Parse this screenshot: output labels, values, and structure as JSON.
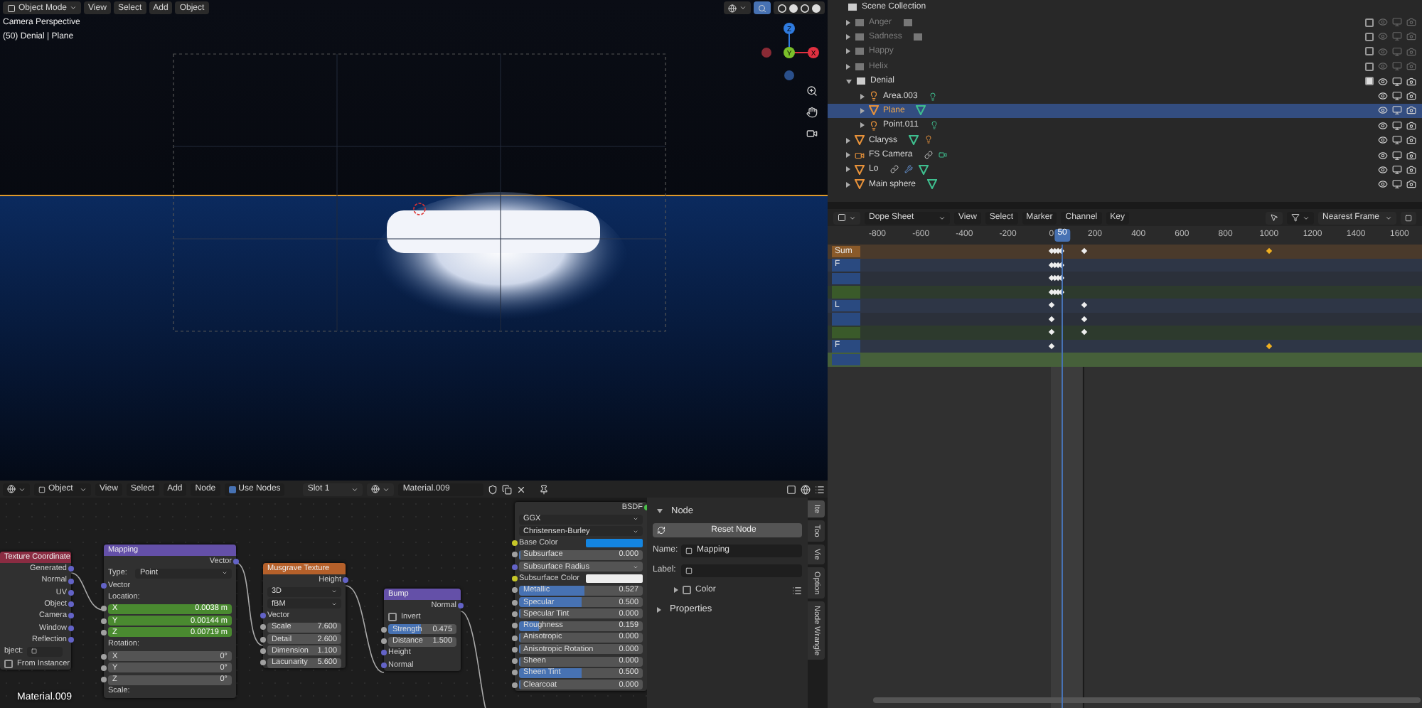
{
  "viewport": {
    "mode": "Object Mode",
    "menus": [
      "View",
      "Select",
      "Add",
      "Object"
    ],
    "overlay": [
      "Camera Perspective",
      "(50) Denial | Plane"
    ],
    "gizmo": {
      "z": "Z",
      "y": "Y",
      "x": "X"
    }
  },
  "outliner": {
    "root": "Scene Collection",
    "items": [
      {
        "name": "Anger",
        "kind": "collection",
        "enabled": false,
        "selected": false,
        "extras": [
          {
            "kind": "collection"
          }
        ]
      },
      {
        "name": "Sadness",
        "kind": "collection",
        "enabled": false,
        "selected": false,
        "extras": [
          {
            "kind": "collection"
          }
        ]
      },
      {
        "name": "Happy",
        "kind": "collection",
        "enabled": false,
        "selected": false
      },
      {
        "name": "Helix",
        "kind": "collection",
        "enabled": false,
        "selected": false
      },
      {
        "name": "Denial",
        "kind": "collection",
        "enabled": true,
        "selected": false,
        "children": [
          {
            "name": "Area.003",
            "kind": "light",
            "enabled": true,
            "selected": false,
            "extras": [
              {
                "kind": "light-data"
              }
            ]
          },
          {
            "name": "Plane",
            "kind": "mesh",
            "enabled": true,
            "selected": true,
            "extras": [
              {
                "kind": "mesh-data"
              }
            ]
          },
          {
            "name": "Point.011",
            "kind": "light",
            "enabled": true,
            "selected": false,
            "extras": [
              {
                "kind": "light-data"
              }
            ]
          }
        ]
      },
      {
        "name": "Claryss",
        "kind": "mesh",
        "enabled": true,
        "selected": false,
        "extras": [
          {
            "kind": "mesh-data"
          },
          {
            "kind": "light"
          }
        ]
      },
      {
        "name": "FS Camera",
        "kind": "camera",
        "enabled": true,
        "selected": false,
        "extras": [
          {
            "kind": "constraint"
          },
          {
            "kind": "camera-data"
          }
        ]
      },
      {
        "name": "Lo",
        "kind": "mesh",
        "enabled": true,
        "selected": false,
        "extras": [
          {
            "kind": "constraint"
          },
          {
            "kind": "modifier"
          },
          {
            "kind": "mesh-data"
          }
        ]
      },
      {
        "name": "Main sphere",
        "kind": "mesh",
        "enabled": true,
        "selected": false,
        "extras": [
          {
            "kind": "mesh-data"
          }
        ]
      }
    ]
  },
  "dope_sheet": {
    "mode": "Dope Sheet",
    "menus": [
      "View",
      "Select",
      "Marker",
      "Channel",
      "Key"
    ],
    "snapping": "Nearest Frame",
    "ruler": [
      "-800",
      "-600",
      "-400",
      "-200",
      "0",
      "200",
      "400",
      "600",
      "800",
      "1000",
      "1200",
      "1400",
      "1600"
    ],
    "current_frame": "50",
    "channels": [
      {
        "kind": "summary",
        "label": "Sum"
      },
      {
        "kind": "object",
        "label": "F"
      },
      {
        "kind": "data"
      },
      {
        "kind": "action"
      },
      {
        "kind": "object",
        "label": "L"
      },
      {
        "kind": "data"
      },
      {
        "kind": "action"
      },
      {
        "kind": "object",
        "label": "F"
      },
      {
        "kind": "material"
      }
    ]
  },
  "node_editor": {
    "object_type": "Object",
    "menus": [
      "View",
      "Select",
      "Add",
      "Node"
    ],
    "use_nodes": {
      "label": "Use Nodes",
      "checked": true
    },
    "slot": "Slot 1",
    "material": "Material.009",
    "overlay": "Material.009",
    "nodes": [
      {
        "kind": "input",
        "title": "Texture Coordinate",
        "rows": [
          {
            "kind": "output",
            "label": "Generated"
          },
          {
            "kind": "output",
            "label": "Normal"
          },
          {
            "kind": "output",
            "label": "UV"
          },
          {
            "kind": "output",
            "label": "Object"
          },
          {
            "kind": "output",
            "label": "Camera"
          },
          {
            "kind": "output",
            "label": "Window"
          },
          {
            "kind": "output",
            "label": "Reflection"
          },
          {
            "kind": "object",
            "label": "bject:"
          },
          {
            "kind": "checkbox",
            "label": "From Instancer",
            "checked": false
          }
        ]
      },
      {
        "kind": "vector",
        "title": "Mapping",
        "rows": [
          {
            "kind": "output",
            "label": "Vector"
          },
          {
            "kind": "dropdown",
            "label": "Type:",
            "value": "Point"
          },
          {
            "kind": "input",
            "label": "Vector"
          },
          {
            "kind": "label",
            "label": "Location:"
          },
          {
            "kind": "number",
            "label": "X",
            "value": "0.0038 m",
            "animated": true
          },
          {
            "kind": "number",
            "label": "Y",
            "value": "0.00144 m",
            "animated": true
          },
          {
            "kind": "number",
            "label": "Z",
            "value": "0.00719 m",
            "animated": true
          },
          {
            "kind": "label",
            "label": "Rotation:"
          },
          {
            "kind": "number",
            "label": "X",
            "value": "0°",
            "animated": false
          },
          {
            "kind": "number",
            "label": "Y",
            "value": "0°",
            "animated": false
          },
          {
            "kind": "number",
            "label": "Z",
            "value": "0°",
            "animated": false
          },
          {
            "kind": "label",
            "label": "Scale:"
          }
        ]
      },
      {
        "kind": "texture",
        "title": "Musgrave Texture",
        "rows": [
          {
            "kind": "output",
            "label": "Height"
          },
          {
            "kind": "dropdown",
            "value": "3D"
          },
          {
            "kind": "dropdown",
            "value": "fBM"
          },
          {
            "kind": "input",
            "label": "Vector"
          },
          {
            "kind": "number",
            "label": "Scale",
            "value": "7.600",
            "animated": false
          },
          {
            "kind": "number",
            "label": "Detail",
            "value": "2.600",
            "animated": false
          },
          {
            "kind": "number",
            "label": "Dimension",
            "value": "1.100",
            "animated": false
          },
          {
            "kind": "number",
            "label": "Lacunarity",
            "value": "5.600",
            "animated": false
          }
        ]
      },
      {
        "kind": "vector",
        "title": "Bump",
        "rows": [
          {
            "kind": "output",
            "label": "Normal"
          },
          {
            "kind": "checkbox",
            "label": "Invert",
            "checked": false
          },
          {
            "kind": "slider",
            "label": "Strength",
            "value": "0.475",
            "level": 0.475
          },
          {
            "kind": "number",
            "label": "Distance",
            "value": "1.500",
            "animated": false
          },
          {
            "kind": "input",
            "label": "Height"
          },
          {
            "kind": "input",
            "label": "Normal"
          }
        ]
      }
    ],
    "bsdf": {
      "output": "BSDF",
      "rows": [
        {
          "kind": "dropdown",
          "value": "GGX"
        },
        {
          "kind": "dropdown",
          "value": "Christensen-Burley"
        },
        {
          "kind": "color",
          "label": "Base Color",
          "color": "#1485e0"
        },
        {
          "kind": "slider",
          "label": "Subsurface",
          "value": "0.000",
          "level": 0
        },
        {
          "kind": "vector",
          "label": "Subsurface Radius"
        },
        {
          "kind": "color",
          "label": "Subsurface Color",
          "color": "#eeeeee"
        },
        {
          "kind": "slider",
          "label": "Metallic",
          "value": "0.527",
          "level": 0.527
        },
        {
          "kind": "slider",
          "label": "Specular",
          "value": "0.500",
          "level": 0.5
        },
        {
          "kind": "slider",
          "label": "Specular Tint",
          "value": "0.000",
          "level": 0
        },
        {
          "kind": "slider",
          "label": "Roughness",
          "value": "0.159",
          "level": 0.159
        },
        {
          "kind": "slider",
          "label": "Anisotropic",
          "value": "0.000",
          "level": 0
        },
        {
          "kind": "slider",
          "label": "Anisotropic Rotation",
          "value": "0.000",
          "level": 0
        },
        {
          "kind": "slider",
          "label": "Sheen",
          "value": "0.000",
          "level": 0
        },
        {
          "kind": "slider",
          "label": "Sheen Tint",
          "value": "0.500",
          "level": 0.5
        },
        {
          "kind": "slider",
          "label": "Clearcoat",
          "value": "0.000",
          "level": 0
        }
      ]
    },
    "sidebar": {
      "panel": "Node",
      "reset": "Reset Node",
      "name_label": "Name:",
      "name_value": "Mapping",
      "label_label": "Label:",
      "color": {
        "label": "Color",
        "checked": false
      },
      "properties": "Properties",
      "tabs": [
        {
          "label": "Ite",
          "selected": true
        },
        {
          "label": "Too",
          "selected": false
        },
        {
          "label": "Vie",
          "selected": false
        },
        {
          "label": "Option",
          "selected": false
        },
        {
          "label": "Node Wrangle",
          "selected": false
        }
      ]
    }
  }
}
